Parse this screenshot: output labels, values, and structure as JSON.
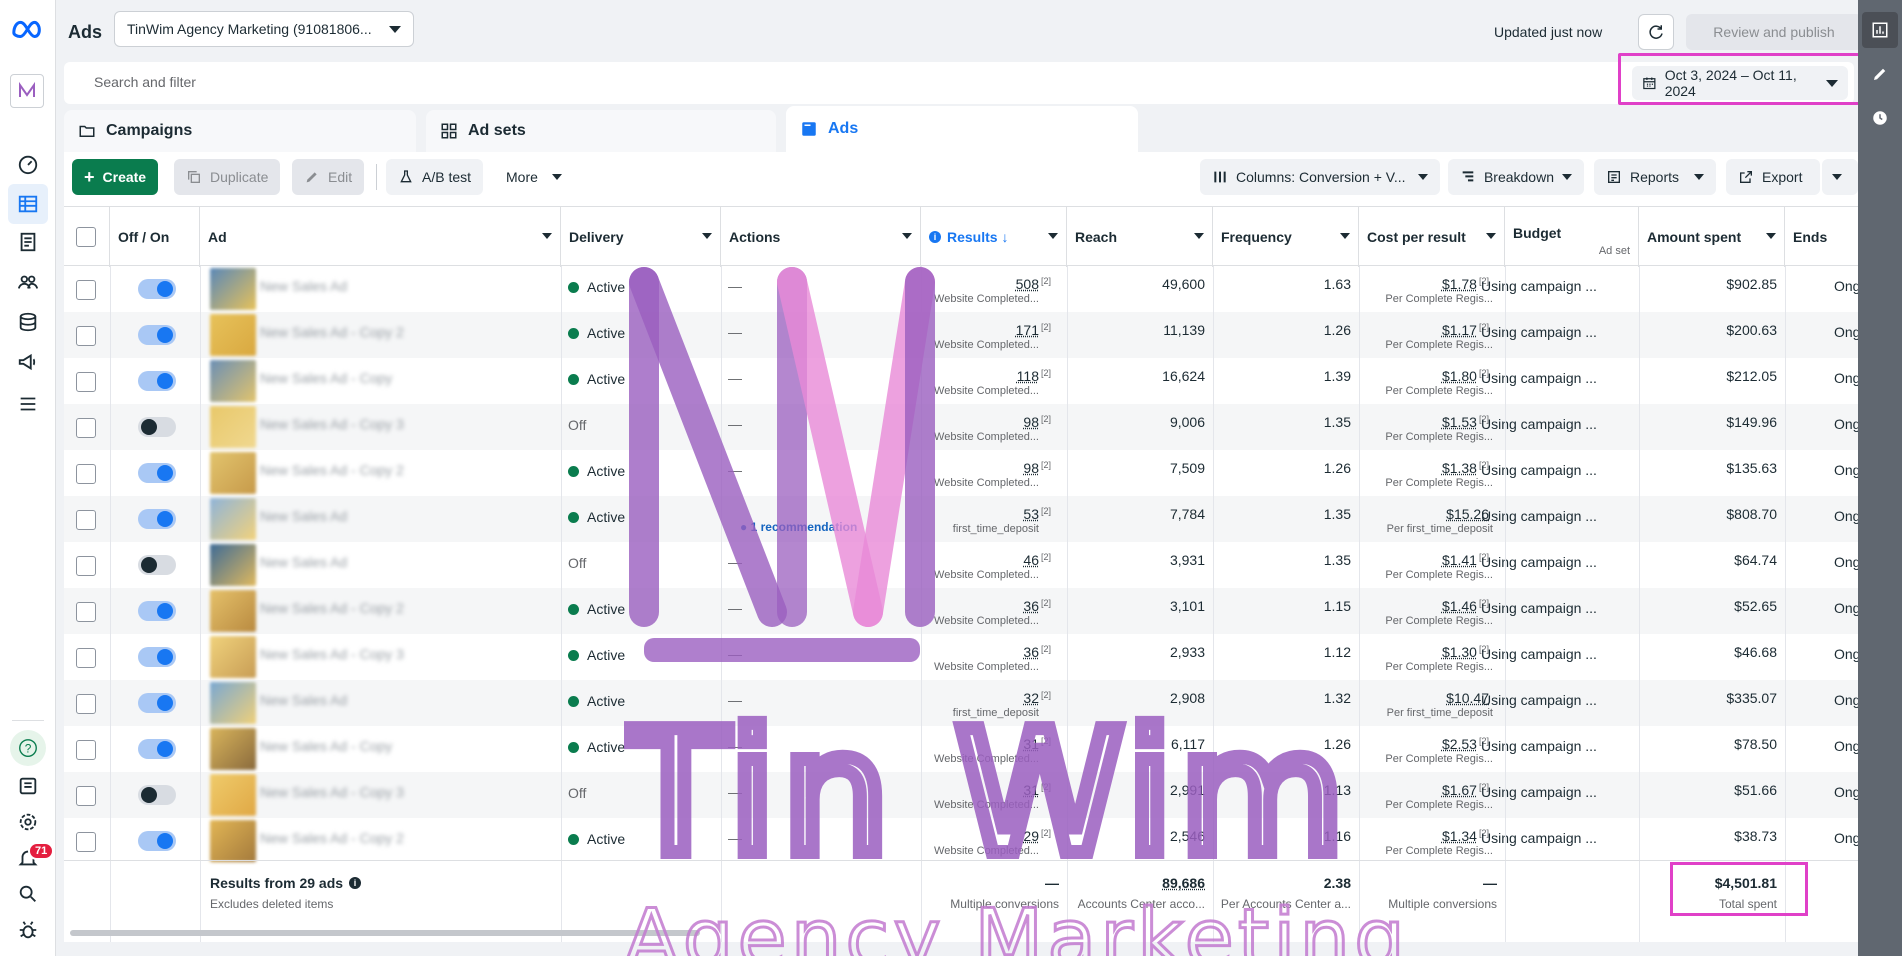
{
  "app": {
    "page_title": "Ads",
    "account_name": "TinWim Agency Marketing (91081806...",
    "updated_label": "Updated just now",
    "publish_label": "Review and publish",
    "more_label": "⋯"
  },
  "search": {
    "placeholder": "Search and filter",
    "date_range": "Oct 3, 2024 – Oct 11, 2024"
  },
  "tabs": [
    {
      "label": "Campaigns"
    },
    {
      "label": "Ad sets"
    },
    {
      "label": "Ads"
    }
  ],
  "toolbar": {
    "create": "Create",
    "duplicate": "Duplicate",
    "edit": "Edit",
    "ab_test": "A/B test",
    "more": "More",
    "columns": "Columns: Conversion + V...",
    "breakdown": "Breakdown",
    "reports": "Reports",
    "export": "Export"
  },
  "columns": {
    "off_on": "Off / On",
    "ad": "Ad",
    "delivery": "Delivery",
    "actions": "Actions",
    "results": "Results ↓",
    "reach": "Reach",
    "frequency": "Frequency",
    "cost_per_result": "Cost per result",
    "budget": "Budget",
    "budget_sub": "Ad set",
    "amount_spent": "Amount spent",
    "ends": "Ends"
  },
  "rows": [
    {
      "on": true,
      "ad": "New Sales Ad",
      "delivery": "Active",
      "action": "—",
      "results": "508",
      "results_sub": "Website Completed...",
      "reach": "49,600",
      "freq": "1.63",
      "cpr": "$1.78",
      "cpr_sub": "Per Complete Regis...",
      "budget": "Using campaign ...",
      "spent": "$902.85",
      "ends": "Ongoing"
    },
    {
      "on": true,
      "ad": "New Sales Ad - Copy 2",
      "delivery": "Active",
      "action": "—",
      "results": "171",
      "results_sub": "Website Completed...",
      "reach": "11,139",
      "freq": "1.26",
      "cpr": "$1.17",
      "cpr_sub": "Per Complete Regis...",
      "budget": "Using campaign ...",
      "spent": "$200.63",
      "ends": "Ongoing"
    },
    {
      "on": true,
      "ad": "New Sales Ad - Copy",
      "delivery": "Active",
      "action": "—",
      "results": "118",
      "results_sub": "Website Completed...",
      "reach": "16,624",
      "freq": "1.39",
      "cpr": "$1.80",
      "cpr_sub": "Per Complete Regis...",
      "budget": "Using campaign ...",
      "spent": "$212.05",
      "ends": "Ongoing"
    },
    {
      "on": false,
      "ad": "New Sales Ad - Copy 3",
      "delivery": "Off",
      "action": "—",
      "results": "98",
      "results_sub": "Website Completed...",
      "reach": "9,006",
      "freq": "1.35",
      "cpr": "$1.53",
      "cpr_sub": "Per Complete Regis...",
      "budget": "Using campaign ...",
      "spent": "$149.96",
      "ends": "Ongoing"
    },
    {
      "on": true,
      "ad": "New Sales Ad - Copy 2",
      "delivery": "Active",
      "action": "—",
      "results": "98",
      "results_sub": "Website Completed...",
      "reach": "7,509",
      "freq": "1.26",
      "cpr": "$1.38",
      "cpr_sub": "Per Complete Regis...",
      "budget": "Using campaign ...",
      "spent": "$135.63",
      "ends": "Ongoing"
    },
    {
      "on": true,
      "ad": "New Sales Ad",
      "delivery": "Active",
      "action": "",
      "recommendation": "1 recommendation",
      "results": "53",
      "results_sub": "first_time_deposit",
      "reach": "7,784",
      "freq": "1.35",
      "cpr": "$15.26",
      "cpr_sub": "Per first_time_deposit",
      "budget": "Using campaign ...",
      "spent": "$808.70",
      "ends": "Ongoing"
    },
    {
      "on": false,
      "ad": "New Sales Ad",
      "delivery": "Off",
      "action": "—",
      "results": "46",
      "results_sub": "Website Completed...",
      "reach": "3,931",
      "freq": "1.35",
      "cpr": "$1.41",
      "cpr_sub": "Per Complete Regis...",
      "budget": "Using campaign ...",
      "spent": "$64.74",
      "ends": "Ongoing"
    },
    {
      "on": true,
      "ad": "New Sales Ad - Copy 2",
      "delivery": "Active",
      "action": "—",
      "results": "36",
      "results_sub": "Website Completed...",
      "reach": "3,101",
      "freq": "1.15",
      "cpr": "$1.46",
      "cpr_sub": "Per Complete Regis...",
      "budget": "Using campaign ...",
      "spent": "$52.65",
      "ends": "Ongoing"
    },
    {
      "on": true,
      "ad": "New Sales Ad - Copy 3",
      "delivery": "Active",
      "action": "—",
      "results": "36",
      "results_sub": "Website Completed...",
      "reach": "2,933",
      "freq": "1.12",
      "cpr": "$1.30",
      "cpr_sub": "Per Complete Regis...",
      "budget": "Using campaign ...",
      "spent": "$46.68",
      "ends": "Ongoing"
    },
    {
      "on": true,
      "ad": "New Sales Ad",
      "delivery": "Active",
      "action": "—",
      "results": "32",
      "results_sub": "first_time_deposit",
      "reach": "2,908",
      "freq": "1.32",
      "cpr": "$10.47",
      "cpr_sub": "Per first_time_deposit",
      "budget": "Using campaign ...",
      "spent": "$335.07",
      "ends": "Ongoing"
    },
    {
      "on": true,
      "ad": "New Sales Ad - Copy",
      "delivery": "Active",
      "action": "—",
      "results": "31",
      "results_sub": "Website Completed...",
      "reach": "6,117",
      "freq": "1.26",
      "cpr": "$2.53",
      "cpr_sub": "Per Complete Regis...",
      "budget": "Using campaign ...",
      "spent": "$78.50",
      "ends": "Ongoing"
    },
    {
      "on": false,
      "ad": "New Sales Ad - Copy 3",
      "delivery": "Off",
      "action": "—",
      "results": "31",
      "results_sub": "Website Completed...",
      "reach": "2,991",
      "freq": "1.13",
      "cpr": "$1.67",
      "cpr_sub": "Per Complete Regis...",
      "budget": "Using campaign ...",
      "spent": "$51.66",
      "ends": "Ongoing"
    },
    {
      "on": true,
      "ad": "New Sales Ad - Copy 2",
      "delivery": "Active",
      "action": "—",
      "results": "29",
      "results_sub": "Website Completed...",
      "reach": "2,546",
      "freq": "1.16",
      "cpr": "$1.34",
      "cpr_sub": "Per Complete Regis...",
      "budget": "Using campaign ...",
      "spent": "$38.73",
      "ends": "Ongoing"
    }
  ],
  "footer": {
    "title": "Results from 29 ads",
    "subtitle": "Excludes deleted items",
    "results": "—",
    "results_sub": "Multiple conversions",
    "reach": "89,686",
    "reach_sub": "Accounts Center acco...",
    "freq": "2.38",
    "freq_sub": "Per Accounts Center a...",
    "cpr": "—",
    "cpr_sub": "Multiple conversions",
    "spent": "$4,501.81",
    "spent_sub": "Total spent"
  },
  "watermark": {
    "line1": "Tin Wim",
    "line2": "Agency Marketing"
  },
  "notifications": {
    "count": "71"
  },
  "colors": {
    "active_green": "#0a7c4e",
    "accent_blue": "#1877f2",
    "highlight_magenta": "#e040c8",
    "watermark_purple": "#9b5fc0",
    "watermark_pink": "#e98ad8"
  }
}
